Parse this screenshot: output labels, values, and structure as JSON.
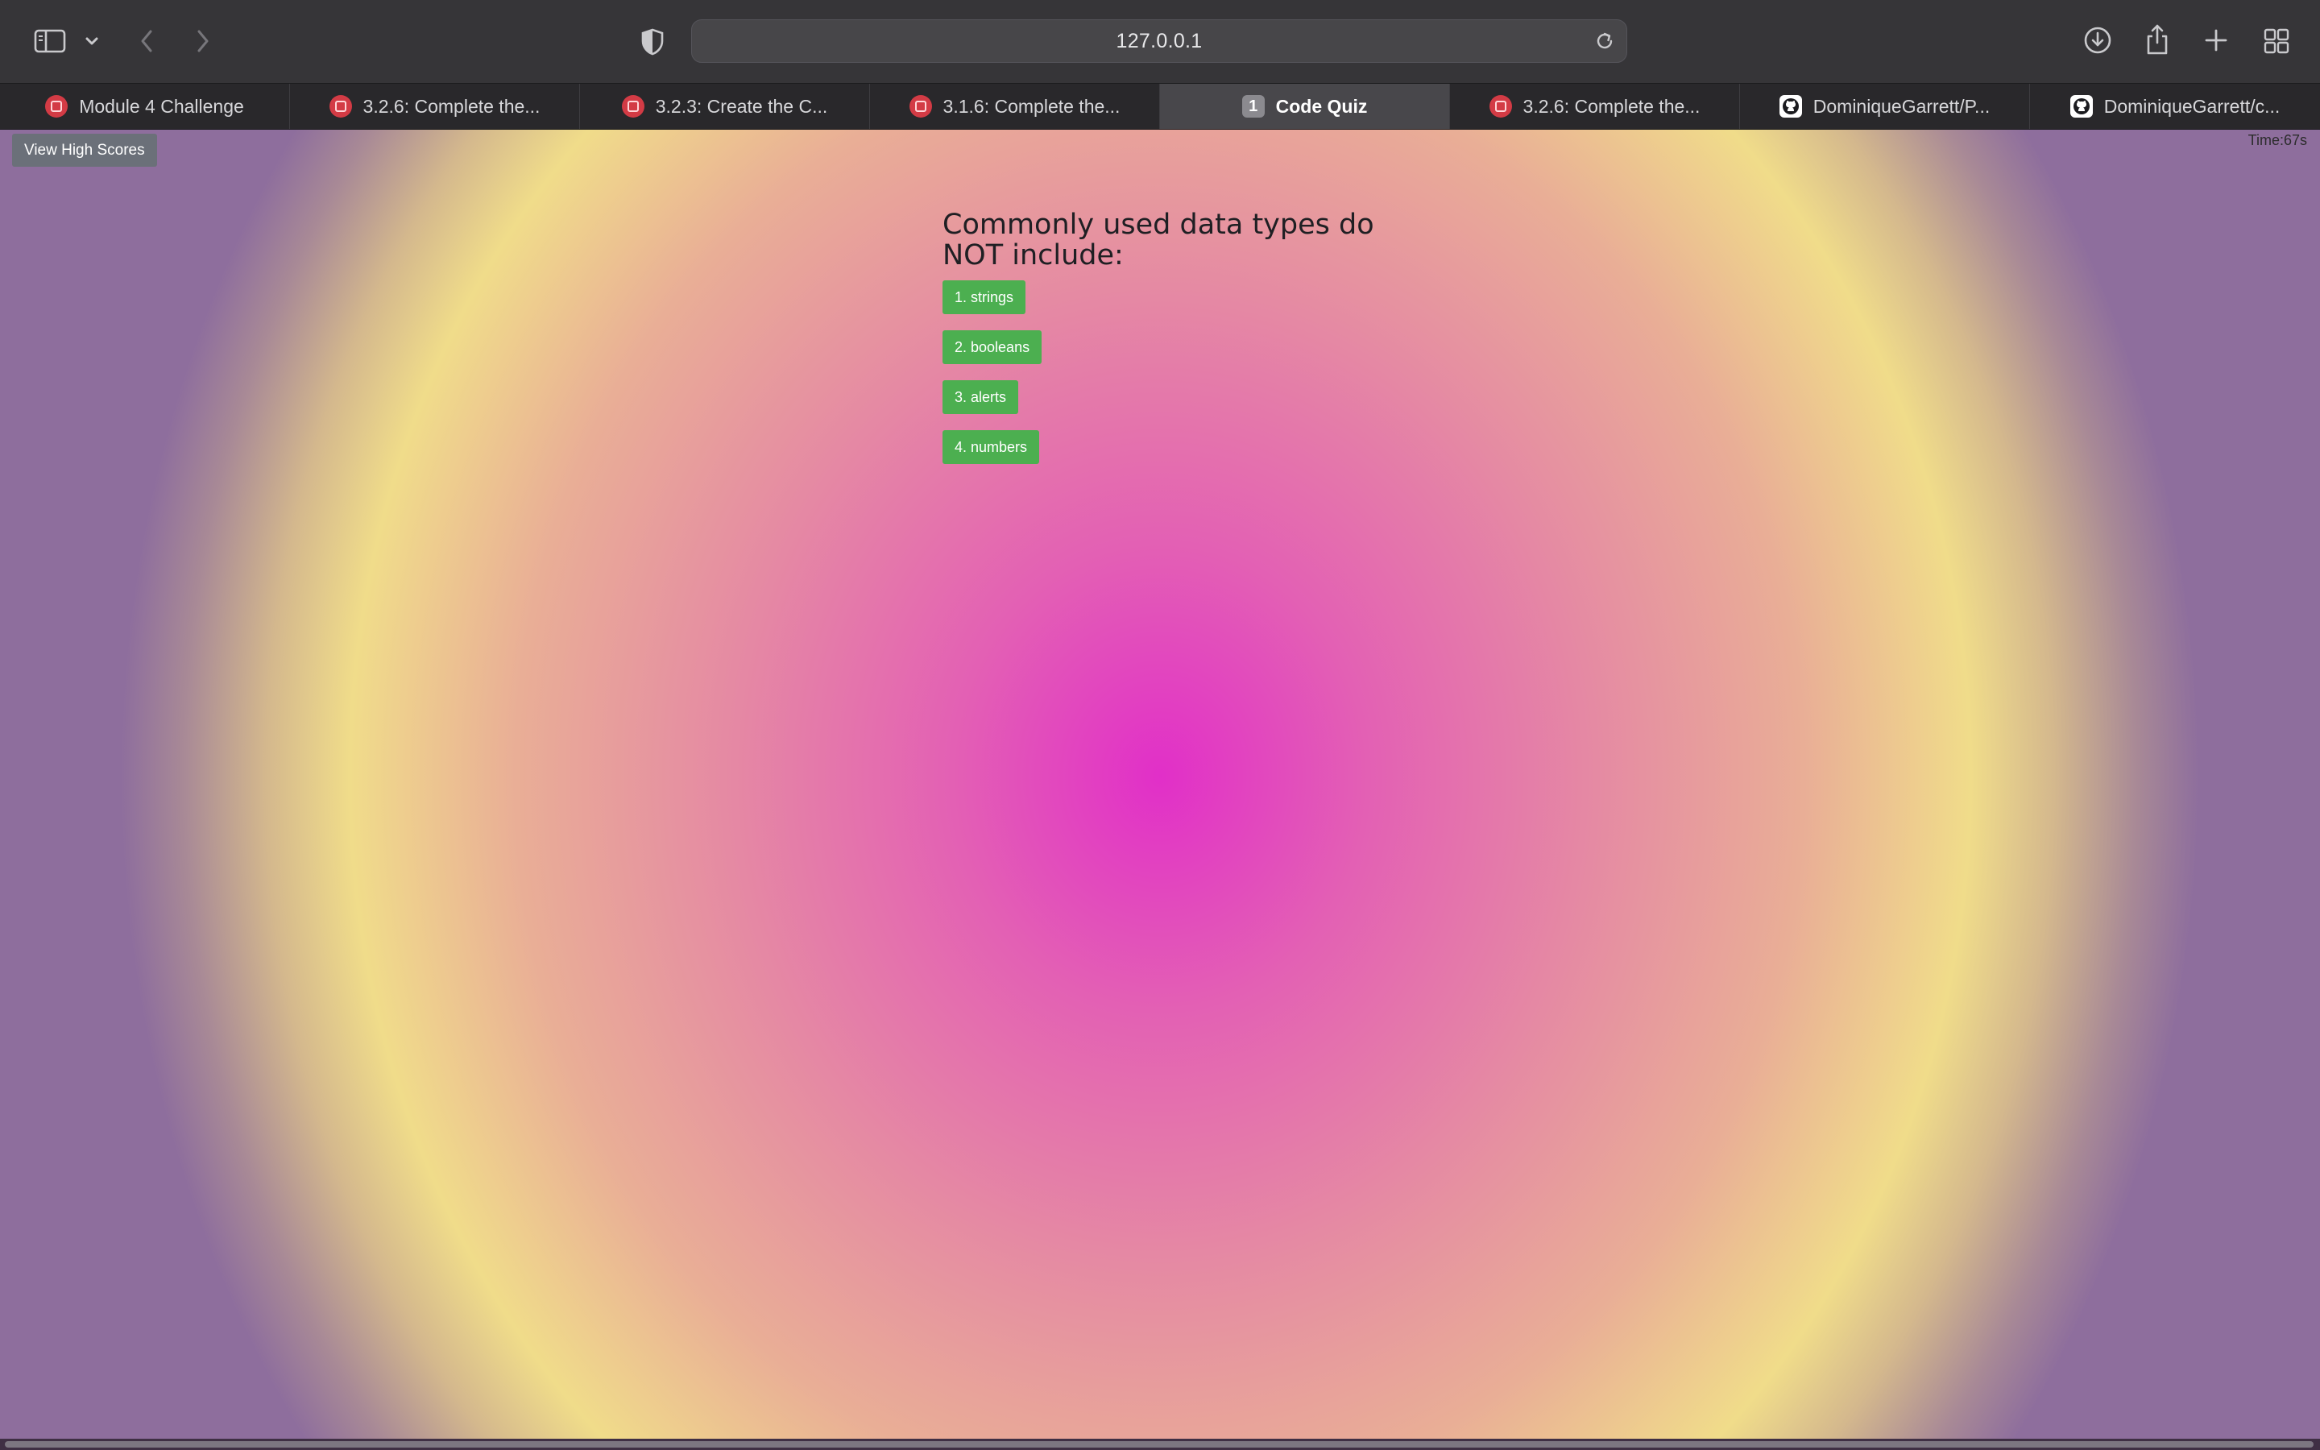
{
  "browser": {
    "address": "127.0.0.1",
    "tabs": [
      {
        "label": "Module 4 Challenge",
        "icon": "canvas-icon",
        "active": false
      },
      {
        "label": "3.2.6: Complete the...",
        "icon": "canvas-icon",
        "active": false
      },
      {
        "label": "3.2.3: Create the C...",
        "icon": "canvas-icon",
        "active": false
      },
      {
        "label": "3.1.6: Complete the...",
        "icon": "canvas-icon",
        "active": false
      },
      {
        "label": "Code Quiz",
        "icon": "badge",
        "badge": "1",
        "active": true
      },
      {
        "label": "3.2.6: Complete the...",
        "icon": "canvas-icon",
        "active": false
      },
      {
        "label": "DominiqueGarrett/P...",
        "icon": "github-icon",
        "active": false
      },
      {
        "label": "DominiqueGarrett/c...",
        "icon": "github-icon",
        "active": false
      }
    ]
  },
  "quiz": {
    "high_scores_label": "View High Scores",
    "timer": "Time:67s",
    "question": "Commonly used data types do NOT include:",
    "answers": [
      "1. strings",
      "2. booleans",
      "3. alerts",
      "4. numbers"
    ],
    "answer_color": "#4caf50"
  },
  "colors": {
    "toolbar": "#363538",
    "tabbar": "#29282b",
    "active_tab": "#48474b",
    "gradient_center": "#e12fc8",
    "gradient_ring": "#f0dc8a"
  }
}
